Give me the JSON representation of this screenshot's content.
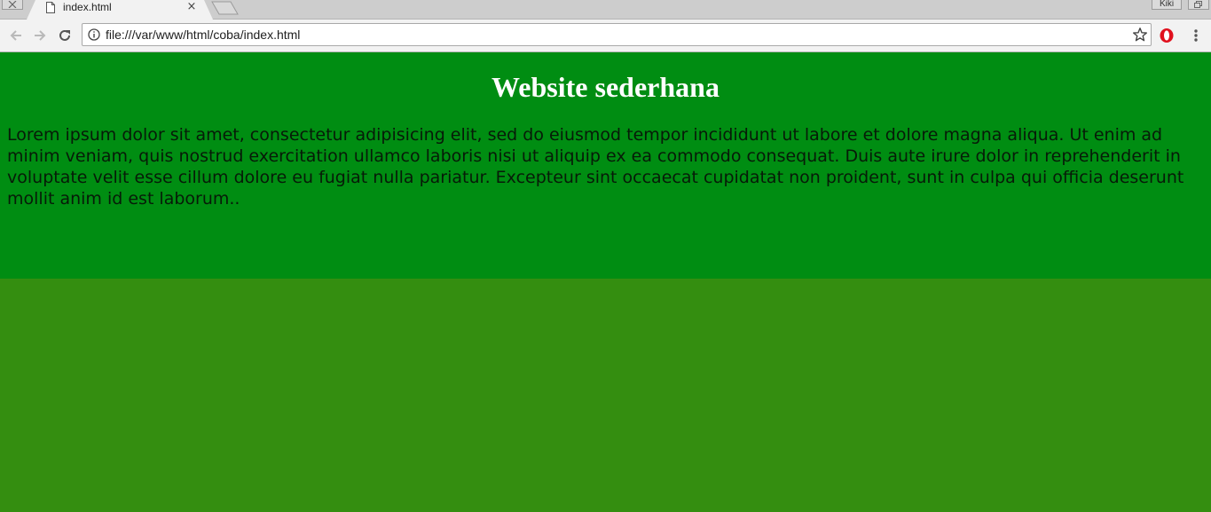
{
  "browser": {
    "tab": {
      "title": "index.html",
      "close_glyph": "×"
    },
    "profile_name": "Kiki",
    "address_bar": {
      "url": "file:///var/www/html/coba/index.html"
    },
    "icons": [
      "back-icon",
      "forward-icon",
      "reload-icon",
      "info-icon",
      "star-icon",
      "opera-icon",
      "menu-icon",
      "page-icon",
      "close-icon"
    ]
  },
  "page": {
    "title": "Website sederhana",
    "body": "Lorem ipsum dolor sit amet, consectetur adipisicing elit, sed do eiusmod tempor incididunt ut labore et dolore magna aliqua. Ut enim ad minim veniam, quis nostrud exercitation ullamco laboris nisi ut aliquip ex ea commodo consequat. Duis aute irure dolor in reprehenderit in voluptate velit esse cillum dolore eu fugiat nulla pariatur. Excepteur sint occaecat cupidatat non proident, sunt in culpa qui officia deserunt mollit anim id est laborum.."
  },
  "colors": {
    "header_bg": "#008d12",
    "page_bg": "#348e10",
    "title_color": "#ffffff",
    "body_text": "#071b08"
  }
}
